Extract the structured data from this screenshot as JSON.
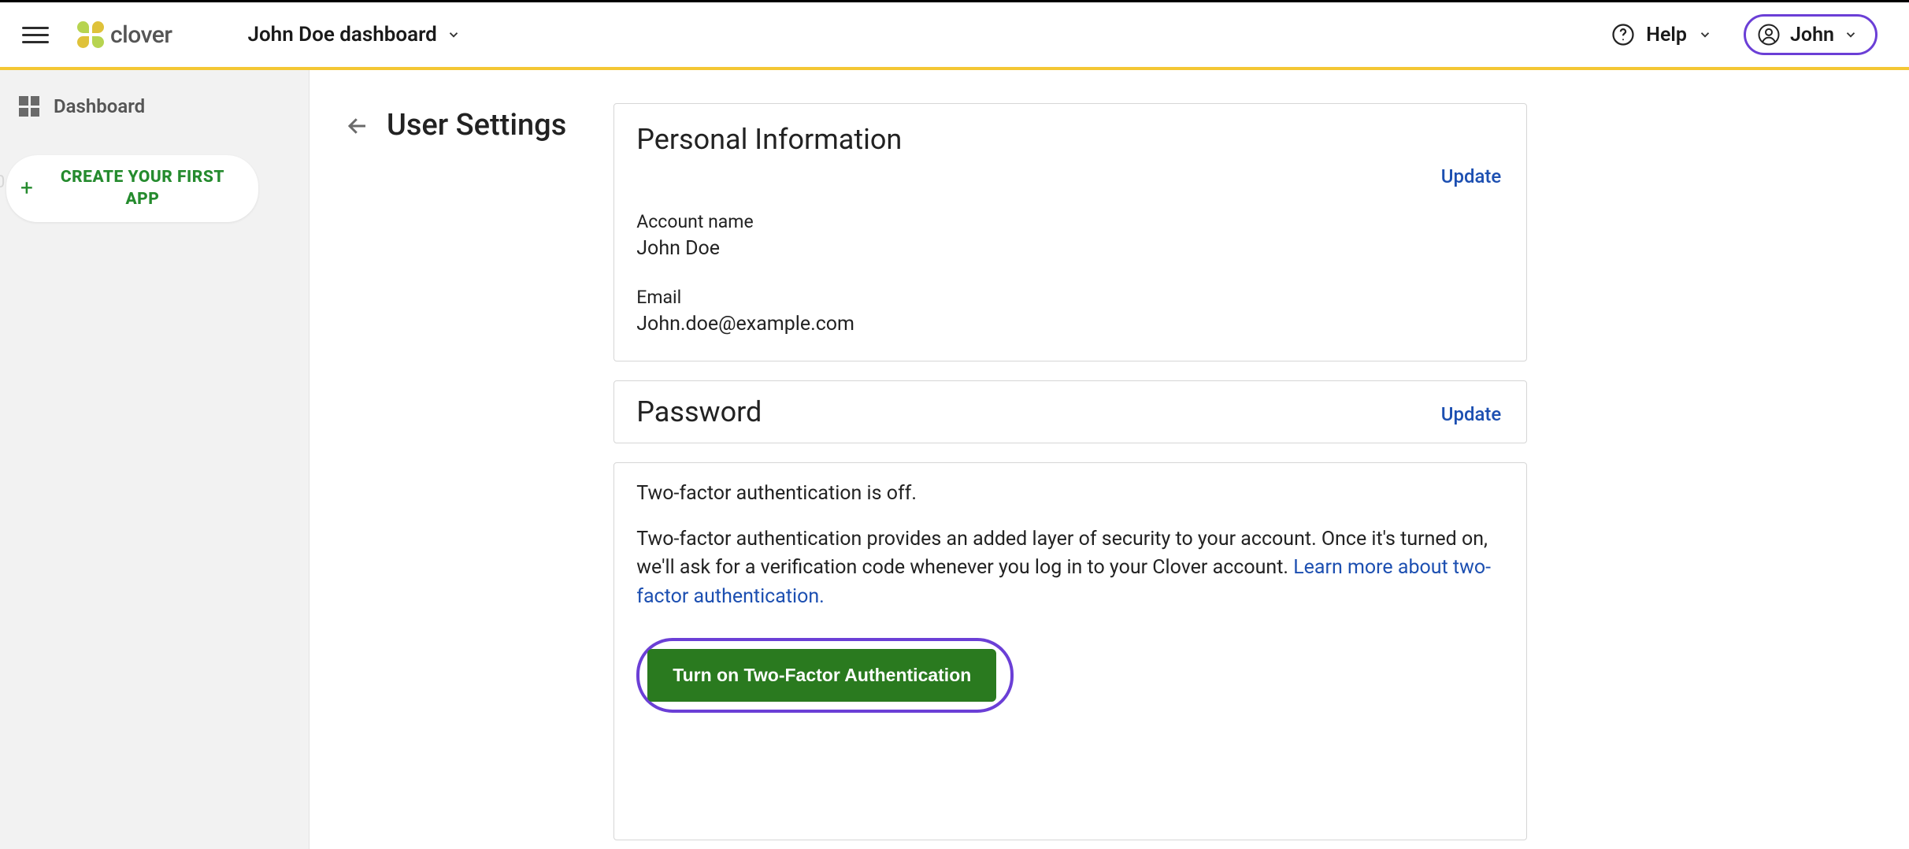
{
  "header": {
    "brand": "clover",
    "dashboard_label": "John Doe dashboard",
    "help_label": "Help",
    "user_label": "John"
  },
  "sidebar": {
    "float_hint": "0",
    "dashboard_label": "Dashboard",
    "create_app_label": "CREATE YOUR FIRST APP"
  },
  "page": {
    "title": "User Settings"
  },
  "personal": {
    "title": "Personal Information",
    "update": "Update",
    "account_name_label": "Account name",
    "account_name_value": "John Doe",
    "email_label": "Email",
    "email_value": "John.doe@example.com"
  },
  "password": {
    "title": "Password",
    "update": "Update"
  },
  "tfa": {
    "status": "Two-factor authentication is off.",
    "description": "Two-factor authentication provides an added layer of security to your account. Once it's turned on, we'll ask for a verification code whenever you log in to your Clover account. ",
    "learn_more": "Learn more about two-factor authentication.",
    "button": "Turn on Two-Factor Authentication"
  }
}
